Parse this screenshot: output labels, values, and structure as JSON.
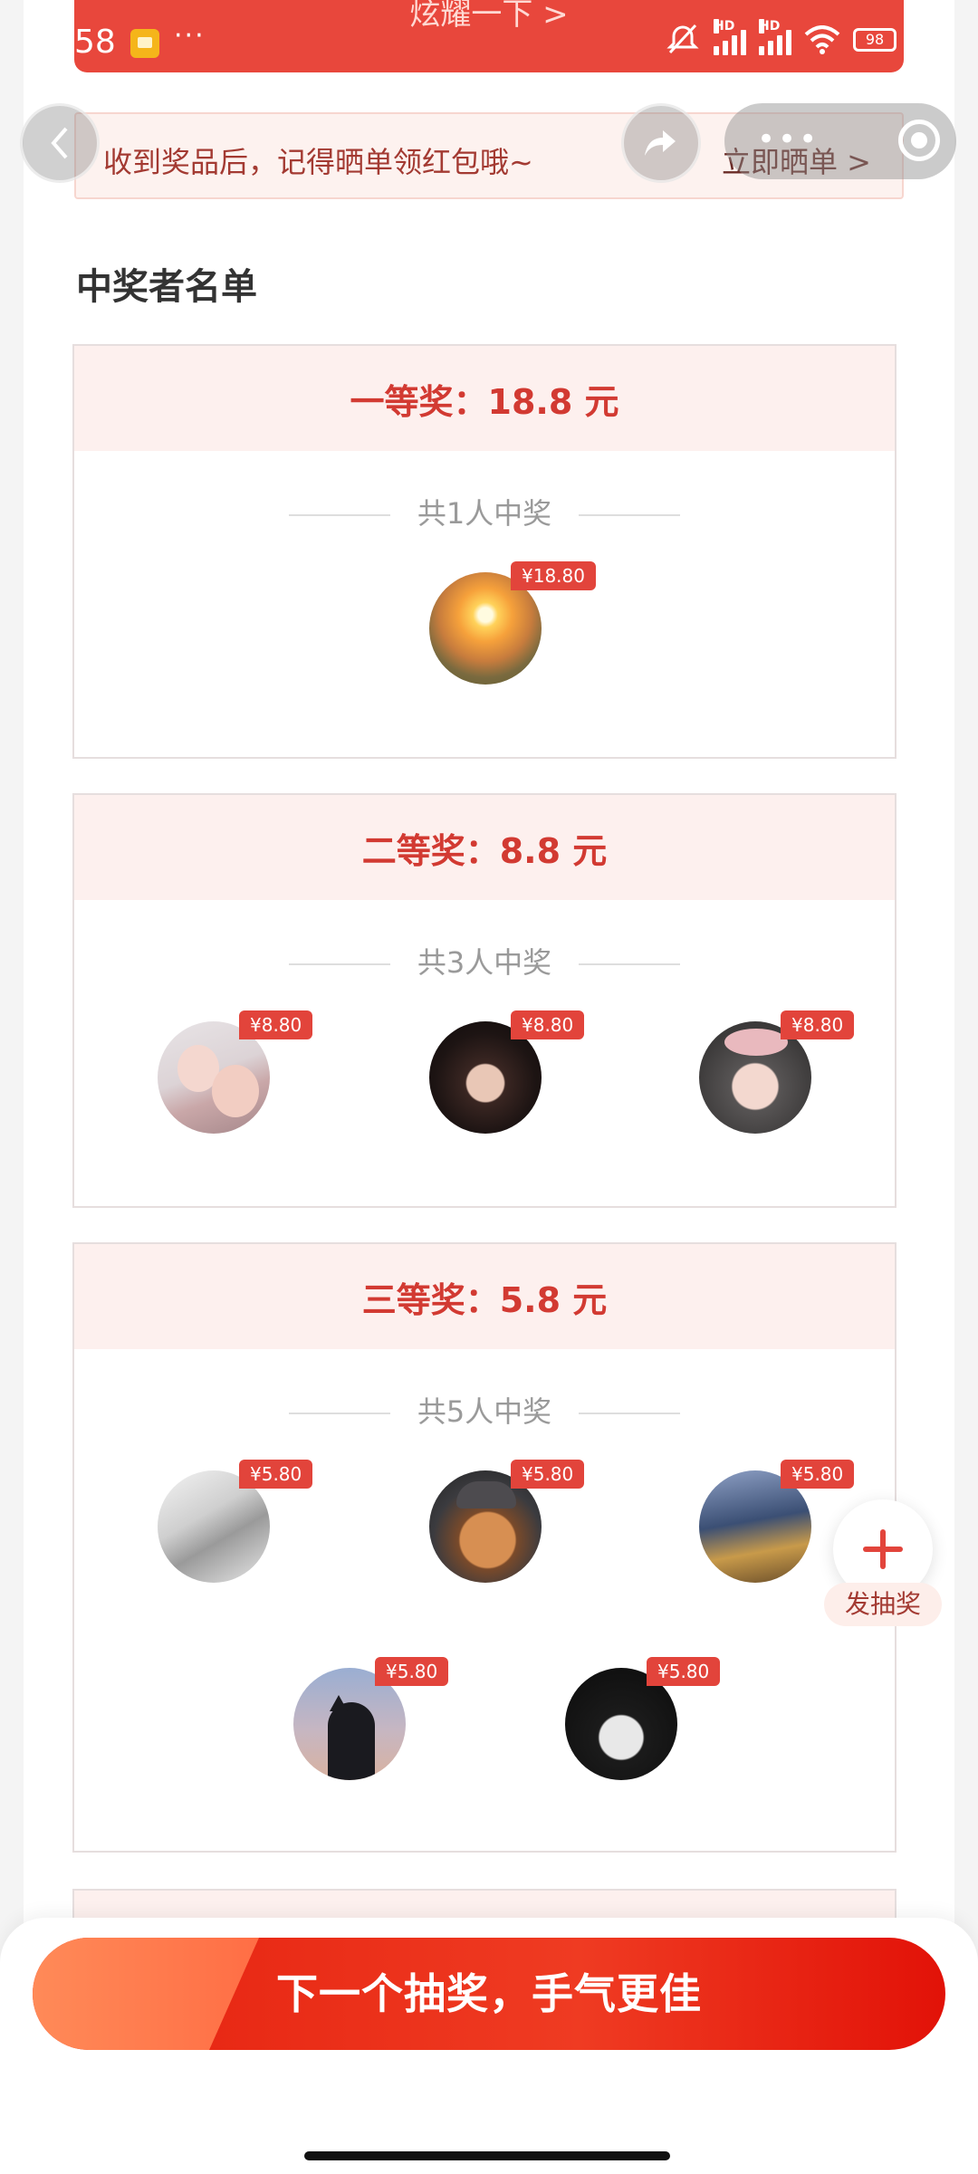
{
  "status_bar": {
    "time": "58",
    "dots": "···",
    "top_text": "炫耀一下 >",
    "battery": "98"
  },
  "tip": {
    "text": "收到奖品后，记得晒单领红包哦~",
    "action": "立即晒单 >"
  },
  "section_title": "中奖者名单",
  "prizes": [
    {
      "title": "一等奖：18.8 元",
      "count": "共1人中奖",
      "winners": [
        {
          "amount": "¥18.80"
        }
      ]
    },
    {
      "title": "二等奖：8.8 元",
      "count": "共3人中奖",
      "winners": [
        {
          "amount": "¥8.80"
        },
        {
          "amount": "¥8.80"
        },
        {
          "amount": "¥8.80"
        }
      ]
    },
    {
      "title": "三等奖：5.8 元",
      "count": "共5人中奖",
      "winners": [
        {
          "amount": "¥5.80"
        },
        {
          "amount": "¥5.80"
        },
        {
          "amount": "¥5.80"
        },
        {
          "amount": "¥5.80"
        },
        {
          "amount": "¥5.80"
        }
      ]
    }
  ],
  "fab": {
    "label": "发抽奖"
  },
  "cta": {
    "label": "下一个抽奖，手气更佳"
  },
  "colors": {
    "accent": "#e2443b",
    "header_bg": "#fdf0ee"
  }
}
